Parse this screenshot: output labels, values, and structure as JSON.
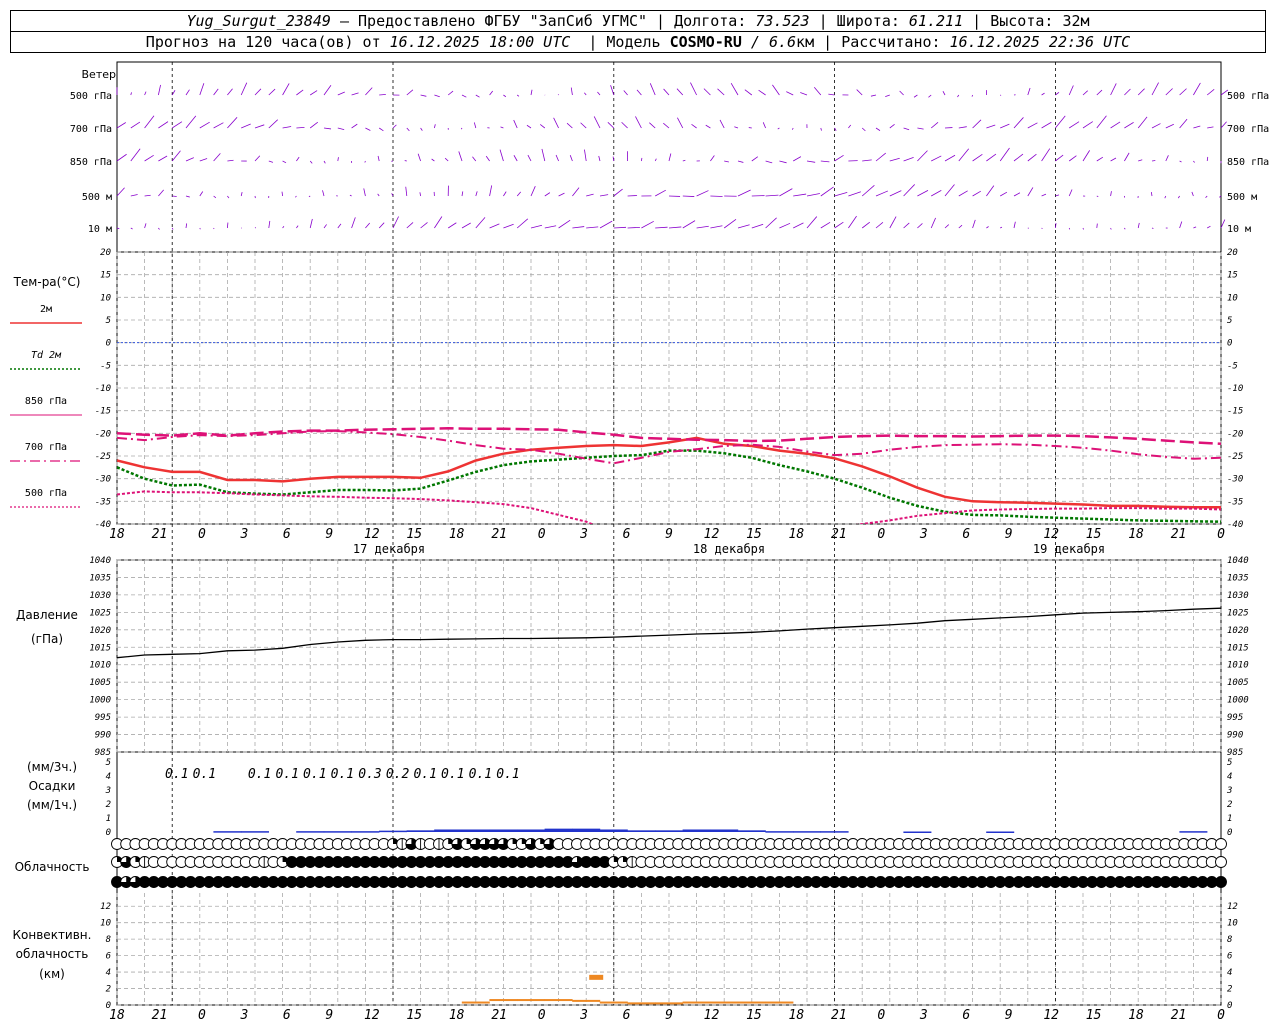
{
  "header": {
    "station": "Yug_Surgut_23849",
    "provider": "— Предоставлено ФГБУ \"ЗапСиб УГМС\"",
    "lon_label": "Долгота:",
    "lon": "73.523",
    "lat_label": "Широта:",
    "lat": "61.211",
    "alt_label": "Высота:",
    "alt": "32м",
    "forecast_label": "Прогноз на 120 часа(ов) от",
    "forecast_time": "16.12.2025 18:00 UTC",
    "model_label": "Модель",
    "model": "COSMO-RU",
    "model_res": "/ 6.6",
    "model_res_unit": "км",
    "calc_label": "Рассчитано:",
    "calc_time": "16.12.2025 22:36 UTC"
  },
  "colors": {
    "wind": "#8800cc",
    "t2m": "#ee3333",
    "td2m": "#007700",
    "t850": "#dd1177",
    "t700": "#dd1177",
    "t500": "#dd1177",
    "pressure": "#000000",
    "precip": "#2233cc",
    "convective": "#ee8822",
    "zero_line": "#3355dd"
  },
  "x_ticks": [
    "18",
    "21",
    "0",
    "3",
    "6",
    "9",
    "12",
    "15",
    "18",
    "21",
    "0",
    "3",
    "6",
    "9",
    "12",
    "15",
    "18",
    "21",
    "0",
    "3",
    "6",
    "9",
    "12",
    "15",
    "18",
    "21",
    "0"
  ],
  "dates": [
    "17 декабря",
    "18 декабря",
    "19 декабря"
  ],
  "wind_panel": {
    "title": "Ветер",
    "levels": [
      "500 гПа",
      "700 гПа",
      "850 гПа",
      "500 м",
      "10 м"
    ]
  },
  "temp_panel": {
    "title": "Тем-ра(°C)",
    "legend": [
      "2м",
      "Td 2м",
      "850 гПа",
      "700 гПа",
      "500 гПа"
    ],
    "y_ticks": [
      "20",
      "15",
      "10",
      "5",
      "0",
      "-5",
      "-10",
      "-15",
      "-20",
      "-25",
      "-30",
      "-35",
      "-40"
    ]
  },
  "pressure_panel": {
    "title": "Давление",
    "unit": "(гПа)",
    "y_ticks": [
      "1040",
      "1035",
      "1030",
      "1025",
      "1020",
      "1015",
      "1010",
      "1005",
      "1000",
      "995",
      "990",
      "985"
    ]
  },
  "precip_panel": {
    "unit_3h": "(мм/3ч.)",
    "title": "Осадки",
    "unit_1h": "(мм/1ч.)",
    "y_ticks": [
      "5",
      "4",
      "3",
      "2",
      "1",
      "0"
    ],
    "labels": [
      "0.1",
      "0.1",
      "0.1",
      "0.1",
      "0.1",
      "0.1",
      "0.3",
      "0.2",
      "0.1",
      "0.1",
      "0.1",
      "0.1"
    ]
  },
  "cloud_panel": {
    "title": "Облачность"
  },
  "conv_panel": {
    "title1": "Конвективн.",
    "title2": "облачность",
    "unit": "(км)",
    "y_ticks": [
      "12",
      "10",
      "8",
      "6",
      "4",
      "2",
      "0"
    ]
  },
  "chart_data": [
    {
      "type": "line",
      "title": "Тем-ра(°C)",
      "x": [
        0,
        3,
        6,
        9,
        12,
        15,
        18,
        21,
        24,
        27,
        30,
        33,
        36,
        39,
        42,
        45,
        48,
        51,
        54,
        57,
        60,
        63,
        66,
        69,
        72,
        75,
        78,
        81,
        84,
        87,
        90,
        93,
        96,
        99,
        102,
        105,
        108,
        111,
        114,
        117,
        120
      ],
      "ylim": [
        -40,
        20
      ],
      "series": [
        {
          "name": "2м",
          "values": [
            -26,
            -27.5,
            -28.5,
            -28.5,
            -30.3,
            -30.3,
            -30.6,
            -30,
            -29.6,
            -29.6,
            -29.6,
            -29.8,
            -28.4,
            -26,
            -24.5,
            -23.6,
            -23.2,
            -22.8,
            -22.6,
            -22.8,
            -22,
            -21,
            -22.3,
            -22.8,
            -23.8,
            -24.5,
            -25.5,
            -27.3,
            -29.5,
            -32,
            -34,
            -35,
            -35.2,
            -35.3,
            -35.5,
            -35.7,
            -36,
            -36,
            -36.2,
            -36.3,
            -36.3
          ]
        },
        {
          "name": "Td 2м",
          "values": [
            -27.5,
            -30,
            -31.5,
            -31.3,
            -33,
            -33.3,
            -33.5,
            -33,
            -32.5,
            -32.5,
            -32.6,
            -32.2,
            -30.4,
            -28.5,
            -27,
            -26.2,
            -25.8,
            -25.4,
            -25,
            -24.8,
            -23.8,
            -23.8,
            -24.4,
            -25.4,
            -27,
            -28.4,
            -30,
            -32,
            -34.2,
            -36,
            -37.3,
            -38,
            -38.1,
            -38.4,
            -38.6,
            -38.8,
            -39,
            -39.2,
            -39.3,
            -39.4,
            -39.5
          ]
        },
        {
          "name": "850 гПа",
          "values": [
            -20,
            -20.3,
            -20.5,
            -20,
            -20.5,
            -20,
            -19.6,
            -19.4,
            -19.4,
            -19.2,
            -19.1,
            -19,
            -18.9,
            -19,
            -19,
            -19.1,
            -19.2,
            -19.8,
            -20.3,
            -21,
            -21.2,
            -21.4,
            -21.5,
            -21.7,
            -21.6,
            -21.2,
            -20.8,
            -20.6,
            -20.5,
            -20.6,
            -20.6,
            -20.7,
            -20.6,
            -20.5,
            -20.5,
            -20.6,
            -20.9,
            -21.2,
            -21.6,
            -22,
            -22.3
          ]
        },
        {
          "name": "700 гПа",
          "values": [
            -21,
            -21.5,
            -20.8,
            -20.4,
            -20.6,
            -20.4,
            -20,
            -19.6,
            -19.5,
            -19.8,
            -20.2,
            -20.8,
            -21.6,
            -22.6,
            -23.4,
            -23.6,
            -24.5,
            -25.6,
            -26.6,
            -25.4,
            -24.1,
            -23.5,
            -22.8,
            -22.5,
            -23,
            -24,
            -24.8,
            -24.5,
            -23.6,
            -23,
            -22.6,
            -22.5,
            -22.4,
            -22.5,
            -22.8,
            -23.2,
            -23.8,
            -24.6,
            -25.2,
            -25.6,
            -25.4
          ]
        },
        {
          "name": "500 гПа",
          "values": [
            -33.5,
            -32.8,
            -33,
            -33,
            -33.2,
            -33.5,
            -33.7,
            -33.9,
            -34,
            -34.2,
            -34.3,
            -34.5,
            -34.8,
            -35.2,
            -35.6,
            -36.5,
            -38,
            -39.5,
            -42,
            -43,
            -44,
            -44.5,
            -44.5,
            -44,
            -43,
            -42,
            -41,
            -40,
            -39.2,
            -38.2,
            -37.6,
            -37,
            -36.8,
            -36.7,
            -36.6,
            -36.6,
            -36.5,
            -36.5,
            -36.6,
            -36.6,
            -36.8
          ]
        }
      ]
    },
    {
      "type": "line",
      "title": "Давление",
      "x": [
        0,
        3,
        6,
        9,
        12,
        15,
        18,
        21,
        24,
        27,
        30,
        33,
        36,
        39,
        42,
        45,
        48,
        51,
        54,
        57,
        60,
        63,
        66,
        69,
        72,
        75,
        78,
        81,
        84,
        87,
        90,
        93,
        96,
        99,
        102,
        105,
        108,
        111,
        114,
        117,
        120
      ],
      "ylim": [
        985,
        1040
      ],
      "series": [
        {
          "name": "",
          "values": [
            1012,
            1012.8,
            1013,
            1013.2,
            1014,
            1014.2,
            1014.7,
            1015.8,
            1016.5,
            1017,
            1017.2,
            1017.2,
            1017.3,
            1017.4,
            1017.5,
            1017.5,
            1017.6,
            1017.7,
            1017.9,
            1018.2,
            1018.5,
            1018.8,
            1019,
            1019.3,
            1019.7,
            1020.2,
            1020.6,
            1021,
            1021.4,
            1021.9,
            1022.6,
            1023,
            1023.4,
            1023.8,
            1024.3,
            1024.8,
            1025,
            1025.2,
            1025.5,
            1025.9,
            1026.2
          ]
        }
      ]
    },
    {
      "type": "bar",
      "title": "Осадки",
      "x": [
        0,
        3,
        6,
        9,
        12,
        15,
        18,
        21,
        24,
        27,
        30,
        33,
        36,
        39,
        42,
        45,
        48,
        51,
        54,
        57,
        60,
        63,
        66,
        69,
        72,
        75,
        78,
        81,
        84,
        87,
        90,
        93,
        96,
        99,
        102,
        105,
        108,
        111,
        114,
        117,
        120
      ],
      "ylim": [
        0,
        5
      ],
      "values": [
        0,
        0,
        0,
        0,
        0.05,
        0.05,
        0,
        0.05,
        0.05,
        0.05,
        0.08,
        0.1,
        0.15,
        0.15,
        0.15,
        0.15,
        0.2,
        0.2,
        0.15,
        0.1,
        0.1,
        0.15,
        0.15,
        0.1,
        0.05,
        0.05,
        0.05,
        0,
        0,
        0.03,
        0,
        0,
        0.03,
        0,
        0,
        0,
        0,
        0,
        0,
        0.05,
        0
      ]
    },
    {
      "type": "bar",
      "title": "Конвективн. облачность",
      "x": [
        0,
        3,
        6,
        9,
        12,
        15,
        18,
        21,
        24,
        27,
        30,
        33,
        36,
        39,
        42,
        45,
        48,
        51,
        54,
        57,
        60,
        63,
        66,
        69,
        72,
        75,
        78,
        81,
        84,
        87,
        90,
        93,
        96,
        99,
        102,
        105,
        108,
        111,
        114,
        117,
        120
      ],
      "ylim": [
        0,
        13
      ],
      "values": [
        0,
        0,
        0,
        0,
        0,
        0,
        0,
        0,
        0,
        0,
        0,
        0,
        0,
        0.3,
        0.6,
        0.6,
        0.6,
        0.5,
        0.3,
        0.2,
        0.2,
        0.3,
        0.3,
        0.3,
        0.3,
        0,
        0,
        0,
        0,
        0,
        0,
        0,
        0,
        0,
        0,
        0,
        0,
        0,
        0,
        0,
        0
      ],
      "bar_top": [
        0,
        0,
        0,
        0,
        0,
        0,
        0,
        0,
        0,
        0,
        0,
        0,
        0,
        0,
        0,
        0,
        0,
        3.3,
        0,
        0,
        0,
        0,
        0,
        0,
        0,
        0,
        0,
        0,
        0,
        0,
        0,
        0,
        0,
        0,
        0,
        0,
        0,
        0,
        0,
        0,
        0
      ]
    }
  ],
  "cloud_rows": {
    "row1": [
      0,
      0,
      0,
      0,
      0,
      0,
      0,
      0,
      0,
      0,
      0,
      0,
      0,
      0,
      0,
      0,
      0,
      0,
      0,
      0,
      0,
      0,
      0,
      0,
      0,
      0,
      0,
      0,
      0,
      0,
      2,
      1,
      3,
      1,
      0,
      1,
      2,
      3,
      2,
      3,
      3,
      3,
      3,
      2,
      2,
      3,
      2,
      3,
      0,
      0,
      0,
      0,
      0,
      0,
      0,
      0,
      0,
      0,
      0,
      0,
      0,
      0,
      0,
      0,
      0,
      0,
      0,
      0,
      0,
      0,
      0,
      0,
      0,
      0,
      0,
      0,
      0,
      0,
      0,
      0,
      0,
      0,
      0,
      0,
      0,
      0,
      0,
      0,
      0,
      0,
      0,
      0,
      0,
      0,
      0,
      0,
      0,
      0,
      0,
      0,
      0,
      0,
      0,
      0,
      0,
      0,
      0,
      0,
      0,
      0,
      0,
      0,
      0,
      0,
      0,
      0,
      0,
      0,
      0,
      0,
      0
    ],
    "row2": [
      2,
      3,
      2,
      1,
      0,
      0,
      0,
      0,
      0,
      0,
      0,
      0,
      0,
      0,
      0,
      0,
      1,
      0,
      2,
      4,
      4,
      4,
      4,
      4,
      4,
      4,
      4,
      4,
      4,
      4,
      4,
      4,
      4,
      4,
      4,
      4,
      4,
      4,
      4,
      4,
      4,
      4,
      4,
      4,
      4,
      4,
      4,
      4,
      4,
      4,
      3,
      4,
      4,
      4,
      2,
      2,
      1,
      0,
      0,
      0,
      0,
      0,
      0,
      0,
      0,
      0,
      0,
      0,
      0,
      0,
      0,
      0,
      0,
      0,
      0,
      0,
      0,
      0,
      0,
      0,
      0,
      0,
      0,
      0,
      0,
      0,
      0,
      0,
      0,
      0,
      0,
      0,
      0,
      0,
      0,
      0,
      0,
      0,
      0,
      0,
      0,
      0,
      0,
      0,
      0,
      0,
      0,
      0,
      0,
      0,
      0,
      0,
      0,
      0,
      0,
      0,
      0,
      0,
      0,
      0,
      0
    ],
    "row3": [
      4,
      3,
      3,
      4,
      4,
      4,
      4,
      4,
      4,
      4,
      4,
      4,
      4,
      4,
      4,
      4,
      4,
      4,
      4,
      4,
      4,
      4,
      4,
      4,
      4,
      4,
      4,
      4,
      4,
      4,
      4,
      4,
      4,
      4,
      4,
      4,
      4,
      4,
      4,
      4,
      4,
      4,
      4,
      4,
      4,
      4,
      4,
      4,
      4,
      4,
      4,
      4,
      4,
      4,
      4,
      4,
      4,
      4,
      4,
      4,
      4,
      4,
      4,
      4,
      4,
      4,
      4,
      4,
      4,
      4,
      4,
      4,
      4,
      4,
      4,
      4,
      4,
      4,
      4,
      4,
      4,
      4,
      4,
      4,
      4,
      4,
      4,
      4,
      4,
      4,
      4,
      4,
      4,
      4,
      4,
      4,
      4,
      4,
      4,
      4,
      4,
      4,
      4,
      4,
      4,
      4,
      4,
      4,
      4,
      4,
      4,
      4,
      4,
      4,
      4,
      4,
      4,
      4,
      4,
      4,
      4
    ]
  }
}
